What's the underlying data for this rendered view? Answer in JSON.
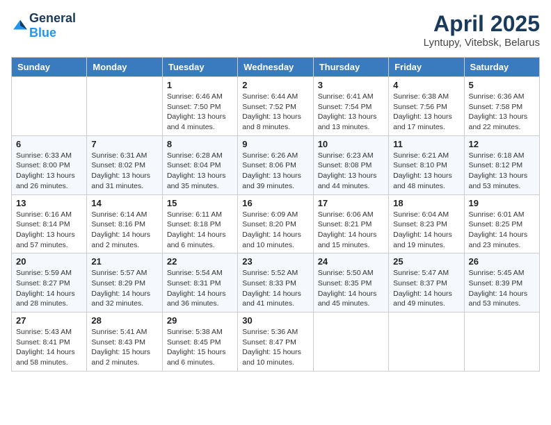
{
  "header": {
    "logo_general": "General",
    "logo_blue": "Blue",
    "month": "April 2025",
    "location": "Lyntupy, Vitebsk, Belarus"
  },
  "weekdays": [
    "Sunday",
    "Monday",
    "Tuesday",
    "Wednesday",
    "Thursday",
    "Friday",
    "Saturday"
  ],
  "weeks": [
    [
      {
        "day": "",
        "info": ""
      },
      {
        "day": "",
        "info": ""
      },
      {
        "day": "1",
        "info": "Sunrise: 6:46 AM\nSunset: 7:50 PM\nDaylight: 13 hours and 4 minutes."
      },
      {
        "day": "2",
        "info": "Sunrise: 6:44 AM\nSunset: 7:52 PM\nDaylight: 13 hours and 8 minutes."
      },
      {
        "day": "3",
        "info": "Sunrise: 6:41 AM\nSunset: 7:54 PM\nDaylight: 13 hours and 13 minutes."
      },
      {
        "day": "4",
        "info": "Sunrise: 6:38 AM\nSunset: 7:56 PM\nDaylight: 13 hours and 17 minutes."
      },
      {
        "day": "5",
        "info": "Sunrise: 6:36 AM\nSunset: 7:58 PM\nDaylight: 13 hours and 22 minutes."
      }
    ],
    [
      {
        "day": "6",
        "info": "Sunrise: 6:33 AM\nSunset: 8:00 PM\nDaylight: 13 hours and 26 minutes."
      },
      {
        "day": "7",
        "info": "Sunrise: 6:31 AM\nSunset: 8:02 PM\nDaylight: 13 hours and 31 minutes."
      },
      {
        "day": "8",
        "info": "Sunrise: 6:28 AM\nSunset: 8:04 PM\nDaylight: 13 hours and 35 minutes."
      },
      {
        "day": "9",
        "info": "Sunrise: 6:26 AM\nSunset: 8:06 PM\nDaylight: 13 hours and 39 minutes."
      },
      {
        "day": "10",
        "info": "Sunrise: 6:23 AM\nSunset: 8:08 PM\nDaylight: 13 hours and 44 minutes."
      },
      {
        "day": "11",
        "info": "Sunrise: 6:21 AM\nSunset: 8:10 PM\nDaylight: 13 hours and 48 minutes."
      },
      {
        "day": "12",
        "info": "Sunrise: 6:18 AM\nSunset: 8:12 PM\nDaylight: 13 hours and 53 minutes."
      }
    ],
    [
      {
        "day": "13",
        "info": "Sunrise: 6:16 AM\nSunset: 8:14 PM\nDaylight: 13 hours and 57 minutes."
      },
      {
        "day": "14",
        "info": "Sunrise: 6:14 AM\nSunset: 8:16 PM\nDaylight: 14 hours and 2 minutes."
      },
      {
        "day": "15",
        "info": "Sunrise: 6:11 AM\nSunset: 8:18 PM\nDaylight: 14 hours and 6 minutes."
      },
      {
        "day": "16",
        "info": "Sunrise: 6:09 AM\nSunset: 8:20 PM\nDaylight: 14 hours and 10 minutes."
      },
      {
        "day": "17",
        "info": "Sunrise: 6:06 AM\nSunset: 8:21 PM\nDaylight: 14 hours and 15 minutes."
      },
      {
        "day": "18",
        "info": "Sunrise: 6:04 AM\nSunset: 8:23 PM\nDaylight: 14 hours and 19 minutes."
      },
      {
        "day": "19",
        "info": "Sunrise: 6:01 AM\nSunset: 8:25 PM\nDaylight: 14 hours and 23 minutes."
      }
    ],
    [
      {
        "day": "20",
        "info": "Sunrise: 5:59 AM\nSunset: 8:27 PM\nDaylight: 14 hours and 28 minutes."
      },
      {
        "day": "21",
        "info": "Sunrise: 5:57 AM\nSunset: 8:29 PM\nDaylight: 14 hours and 32 minutes."
      },
      {
        "day": "22",
        "info": "Sunrise: 5:54 AM\nSunset: 8:31 PM\nDaylight: 14 hours and 36 minutes."
      },
      {
        "day": "23",
        "info": "Sunrise: 5:52 AM\nSunset: 8:33 PM\nDaylight: 14 hours and 41 minutes."
      },
      {
        "day": "24",
        "info": "Sunrise: 5:50 AM\nSunset: 8:35 PM\nDaylight: 14 hours and 45 minutes."
      },
      {
        "day": "25",
        "info": "Sunrise: 5:47 AM\nSunset: 8:37 PM\nDaylight: 14 hours and 49 minutes."
      },
      {
        "day": "26",
        "info": "Sunrise: 5:45 AM\nSunset: 8:39 PM\nDaylight: 14 hours and 53 minutes."
      }
    ],
    [
      {
        "day": "27",
        "info": "Sunrise: 5:43 AM\nSunset: 8:41 PM\nDaylight: 14 hours and 58 minutes."
      },
      {
        "day": "28",
        "info": "Sunrise: 5:41 AM\nSunset: 8:43 PM\nDaylight: 15 hours and 2 minutes."
      },
      {
        "day": "29",
        "info": "Sunrise: 5:38 AM\nSunset: 8:45 PM\nDaylight: 15 hours and 6 minutes."
      },
      {
        "day": "30",
        "info": "Sunrise: 5:36 AM\nSunset: 8:47 PM\nDaylight: 15 hours and 10 minutes."
      },
      {
        "day": "",
        "info": ""
      },
      {
        "day": "",
        "info": ""
      },
      {
        "day": "",
        "info": ""
      }
    ]
  ]
}
